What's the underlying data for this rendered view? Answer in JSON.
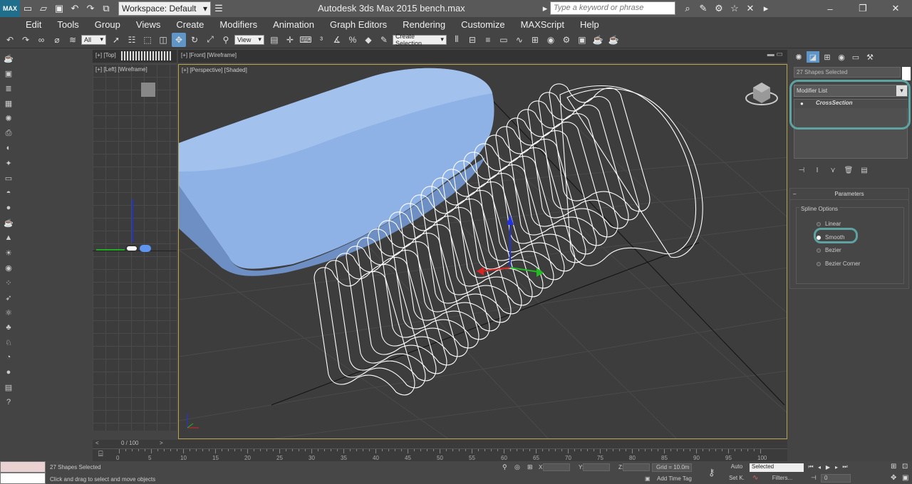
{
  "titlebar": {
    "app_title": "Autodesk 3ds Max  2015     bench.max",
    "logo_text": "MAX",
    "workspace_label": "Workspace: Default",
    "search_placeholder": "Type a keyword or phrase"
  },
  "menu": [
    "Edit",
    "Tools",
    "Group",
    "Views",
    "Create",
    "Modifiers",
    "Animation",
    "Graph Editors",
    "Rendering",
    "Customize",
    "MAXScript",
    "Help"
  ],
  "toolbar": {
    "selection_filter": "All",
    "ref_coord": "View",
    "named_selection": "Create Selection"
  },
  "viewports": {
    "top_label": "[+] [Top]",
    "front_label": "[+] [Front] [Wireframe]",
    "left_label": "[+] [Left] [Wireframe]",
    "perspective_label": "[+] [Perspective] [Shaded]"
  },
  "command_panel": {
    "selection_name": "27 Shapes Selected",
    "modifier_list": "Modifier List",
    "stack_item": "CrossSection",
    "rollout_title": "Parameters",
    "group_title": "Spline Options",
    "options": [
      {
        "label": "Linear",
        "selected": false
      },
      {
        "label": "Smooth",
        "selected": true
      },
      {
        "label": "Bezier",
        "selected": false
      },
      {
        "label": "Bezier Corner",
        "selected": false
      }
    ]
  },
  "timeline": {
    "slider_label": "0 / 100",
    "ticks": [
      "0",
      "5",
      "10",
      "15",
      "20",
      "25",
      "30",
      "35",
      "40",
      "45",
      "50",
      "55",
      "60",
      "65",
      "70",
      "75",
      "80",
      "85",
      "90",
      "95",
      "100"
    ]
  },
  "status": {
    "selection_status": "27 Shapes Selected",
    "prompt": "Click and drag to select and move objects",
    "x_label": "X:",
    "y_label": "Y:",
    "z_label": "Z:",
    "grid": "Grid = 10.0m",
    "add_time_tag": "Add Time Tag",
    "auto_key": "Auto",
    "key_mode": "Selected",
    "set_key": "Set K.",
    "filters": "Filters...",
    "frame": "0"
  }
}
